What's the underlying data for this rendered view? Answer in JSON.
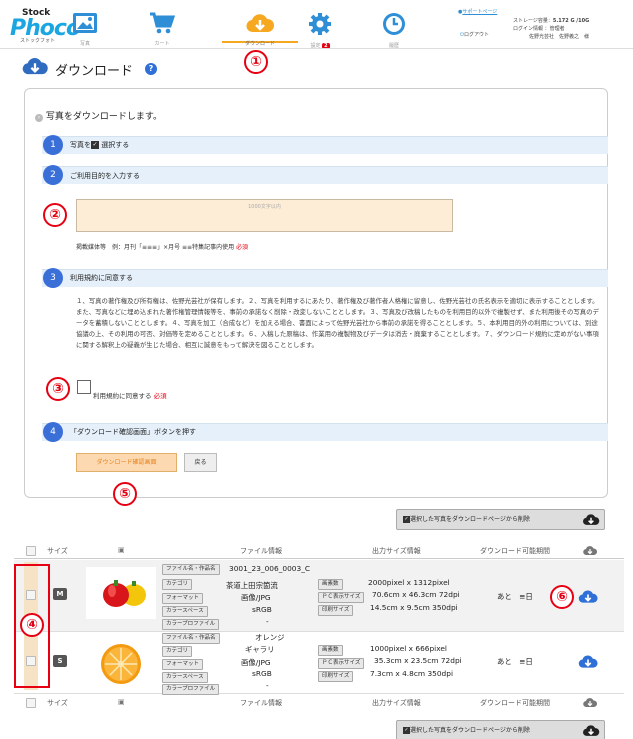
{
  "header": {
    "logo_top": "Stock",
    "logo_main": "Phoco",
    "logo_sub": "ストックフォト",
    "nav": [
      {
        "label": "写真",
        "icon": "image-icon"
      },
      {
        "label": "カート",
        "icon": "cart-icon"
      },
      {
        "label": "ダウンロード",
        "icon": "cloud-download-icon"
      },
      {
        "label": "設定",
        "icon": "gear-icon",
        "badge": "2"
      },
      {
        "label": "履歴",
        "icon": "clock-icon"
      }
    ],
    "support_link": "サポートページ",
    "logout": "ログアウト",
    "storage_label": "ストレージ容量：",
    "storage_value": "5.172 G /10G",
    "login_label": "ログイン情報 ：",
    "login_value": "管理者",
    "company": "佐野光芸社　佐野義之　様"
  },
  "annotations": [
    "①",
    "②",
    "③",
    "④",
    "⑤",
    "⑥"
  ],
  "page": {
    "title": "ダウンロード",
    "help": "?"
  },
  "panel": {
    "intro": "写真をダウンロードします。",
    "step1_num": "1",
    "step1_pre": "写真を",
    "step1_post": "選択する",
    "step2_num": "2",
    "step2_text": "ご利用目的を入力する",
    "textarea_placeholder": "1000文字以内",
    "example_text": "掲載媒体等　例：月刊「≡≡≡」×月号 ≡≡特集記事内使用",
    "required": "必須",
    "step3_num": "3",
    "step3_text": "利用規約に同意する",
    "terms": "１、写真の著作権及び所有権は、佐野光芸社が保有します。２、写真を利用するにあたり、著作権及び著作者人格権に留意し、佐野光芸社の氏名表示を適切に表示することとします。また、写真などに埋め込まれた著作権管理情報等を、事前の承諾なく削除・改変しないこととします。３、写真及び改稿したものを利用目的以外で複製せず、また利用後その写真のデータを蓄積しないこととします。４、写真を加工（合成など）を加える場合、書面によって佐野光芸社から事前の承諾を得ることとします。５、本利用目的外の利用については、別途協議の上、その利用の可否、対価等を定めることとします。６、入稿した原稿は、作業用の複製物及びデータは消去・廃棄することとします。７、ダウンロード規約に定めがない事項に関する解釈上の疑義が生じた場合、相互に誠意をもって解決を図ることとします。",
    "agree_label": "利用規約に同意する",
    "step4_num": "4",
    "step4_text": "「ダウンロード確認画面」ボタンを押す",
    "confirm_btn": "ダウンロード確認画面",
    "back_btn": "戻る"
  },
  "dl_selected_btn": "選択した写真をダウンロードページから削除",
  "table": {
    "headers": {
      "size": "サイズ",
      "file": "ファイル情報",
      "output": "出力サイズ情報",
      "period": "ダウンロード可能期間"
    },
    "file_labels": [
      "ファイル名・作品名",
      "カテゴリ",
      "フォーマット",
      "カラースペース",
      "カラープロファイル"
    ],
    "output_labels": [
      "画素数",
      "ＰＣ表示サイズ",
      "印刷サイズ"
    ],
    "rows": [
      {
        "size": "M",
        "image": "pepper",
        "filename": "3001_23_006_0003_C",
        "category": "茶道上田宗箇流",
        "format": "画像/JPG",
        "colorspace": "sRGB",
        "profile": "-",
        "pixels": "2000pixel x 1312pixel",
        "pc_size": "70.6cm x 46.3cm 72dpi",
        "print_size": "14.5cm x 9.5cm 350dpi",
        "period": "あと　≡日"
      },
      {
        "size": "S",
        "image": "orange",
        "filename": "オレンジ",
        "category": "ギャラリ",
        "format": "画像/JPG",
        "colorspace": "sRGB",
        "profile": "-",
        "pixels": "1000pixel x 666pixel",
        "pc_size": "35.3cm x 23.5cm 72dpi",
        "print_size": "7.3cm x 4.8cm 350dpi",
        "period": "あと　≡日"
      }
    ]
  },
  "colors": {
    "accent_blue": "#3a6fd8",
    "accent_orange": "#f6a821",
    "annotation_red": "#e60012"
  }
}
